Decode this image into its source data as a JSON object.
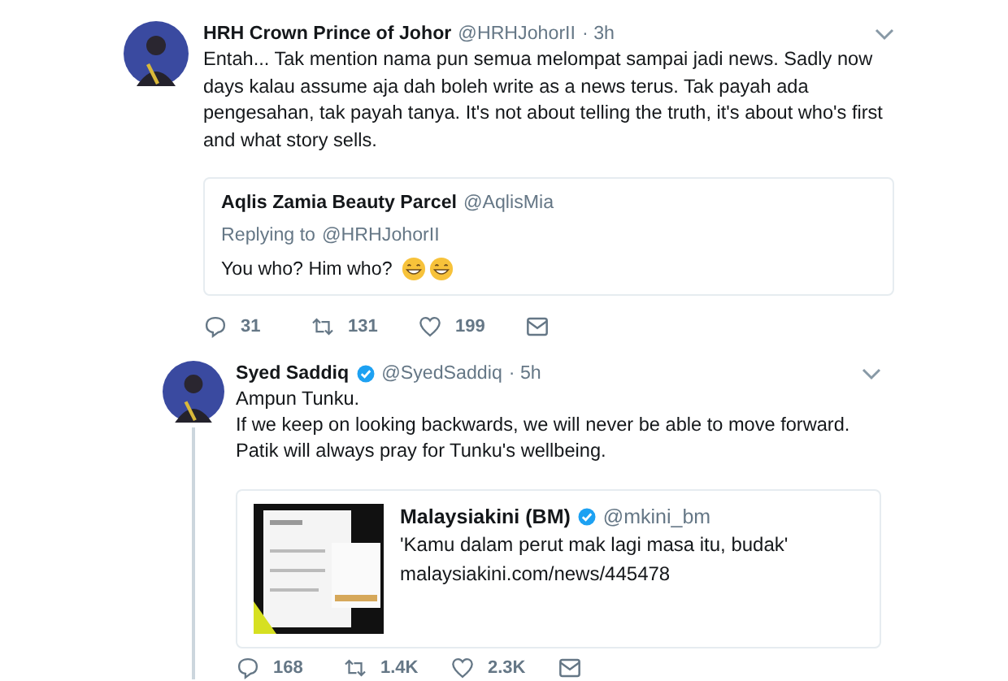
{
  "tweets": [
    {
      "author": "HRH Crown Prince of Johor",
      "verified": false,
      "handle": "@HRHJohorII",
      "time": "· 3h",
      "lines": [
        "Entah... Tak mention nama pun semua melompat sampai jadi news. Sadly now days kalau assume aja dah boleh write as a news terus. Tak payah ada pengesahan, tak payah tanya. It's not about telling the truth, it's about who's first and what story sells."
      ],
      "quote": {
        "author": "Aqlis Zamia Beauty Parcel",
        "handle": "@AqlisMia",
        "replying_label": "Replying to",
        "replying_handle": "@HRHJohorII",
        "text": "You who? Him who?"
      },
      "thread": false,
      "actions": {
        "replies": "31",
        "retweets": "131",
        "likes": "199"
      }
    },
    {
      "author": "Syed Saddiq",
      "verified": true,
      "handle": "@SyedSaddiq",
      "time": "· 5h",
      "lines": [
        "Ampun Tunku.",
        "If we keep on looking backwards, we will never be able to move forward.",
        "Patik will always pray for Tunku's wellbeing."
      ],
      "card": {
        "title": "Malaysiakini (BM)",
        "verified": true,
        "handle": "@mkini_bm",
        "headline": "'Kamu dalam perut mak lagi masa itu, budak'",
        "url": "malaysiakini.com/news/445478"
      },
      "thread": true,
      "actions": {
        "replies": "168",
        "retweets": "1.4K",
        "likes": "2.3K"
      }
    }
  ]
}
